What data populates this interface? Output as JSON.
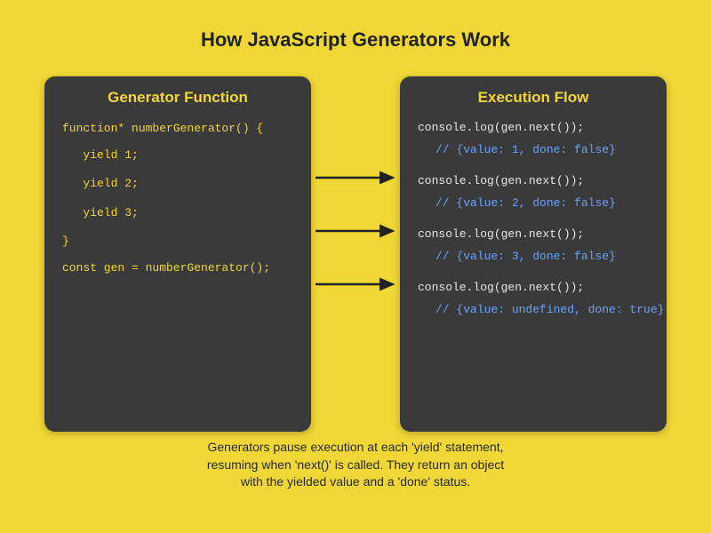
{
  "title": "How JavaScript Generators Work",
  "leftPanel": {
    "title": "Generator Function",
    "lines": [
      "function* numberGenerator() {",
      "   yield 1;",
      "   yield 2;",
      "   yield 3;",
      "}",
      "",
      "const gen = numberGenerator();"
    ]
  },
  "rightPanel": {
    "title": "Execution Flow",
    "blocks": [
      {
        "call": "console.log(gen.next());",
        "result": "// {value: 1, done: false}"
      },
      {
        "call": "console.log(gen.next());",
        "result": "// {value: 2, done: false}"
      },
      {
        "call": "console.log(gen.next());",
        "result": "// {value: 3, done: false}"
      },
      {
        "call": "console.log(gen.next());",
        "result": "// {value: undefined, done: true}"
      }
    ]
  },
  "caption": {
    "l1": "Generators pause execution at each 'yield' statement,",
    "l2": "resuming when 'next()' is called. They return an object",
    "l3": "with the yielded value and a 'done' status."
  }
}
